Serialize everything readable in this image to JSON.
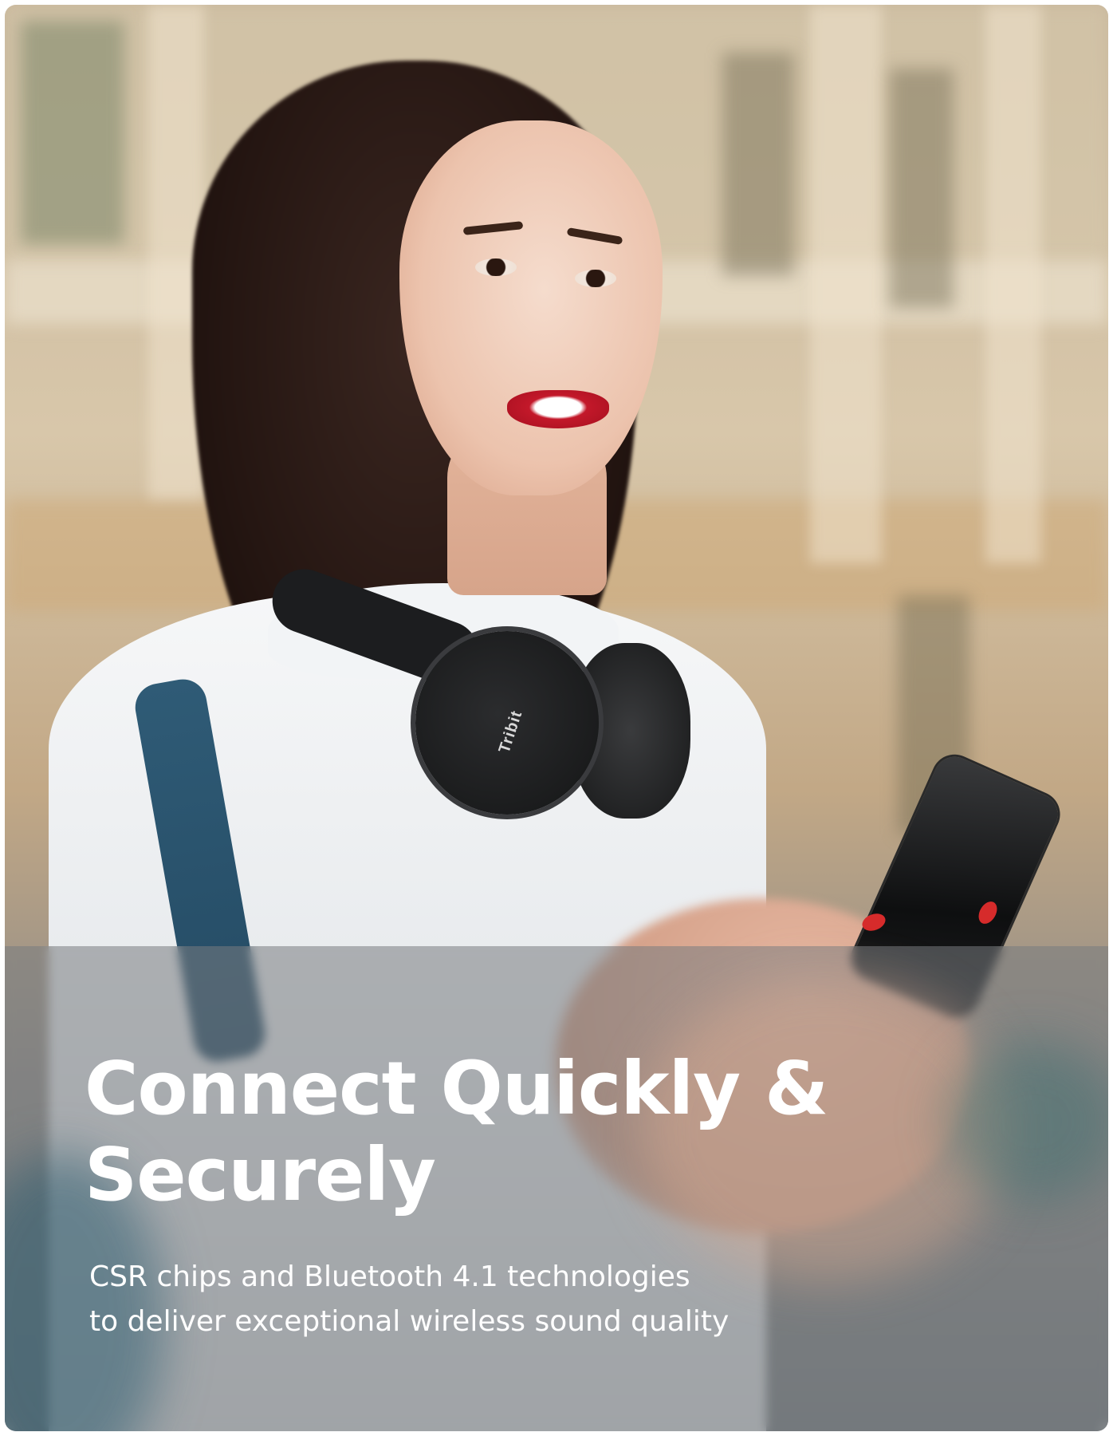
{
  "image": {
    "subject": "woman-with-headphones-and-phone",
    "headphone_brand": "Tribit"
  },
  "overlay": {
    "headline_line1": "Connect Quickly &",
    "headline_line2": "Securely",
    "subtext_line1": "CSR chips and Bluetooth 4.1 technologies",
    "subtext_line2": "to deliver exceptional wireless sound quality"
  },
  "colors": {
    "overlay_tint": "#787c80",
    "text": "#ffffff",
    "lipstick": "#c3182a",
    "headphones": "#1b1c1d",
    "backpack_strap": "#2f5b76"
  }
}
